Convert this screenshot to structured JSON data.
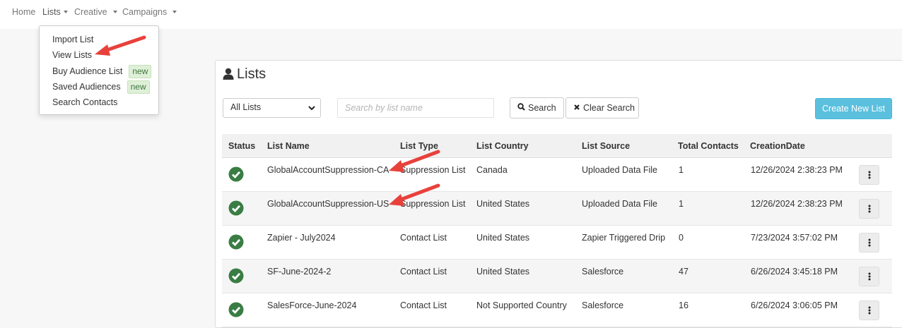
{
  "nav": {
    "home": "Home",
    "lists": "Lists",
    "creative": "Creative",
    "campaigns": "Campaigns"
  },
  "dropdown": {
    "items": [
      {
        "label": "Import List",
        "badge": ""
      },
      {
        "label": "View Lists",
        "badge": ""
      },
      {
        "label": "Buy Audience List",
        "badge": "new"
      },
      {
        "label": "Saved Audiences",
        "badge": "new"
      },
      {
        "label": "Search Contacts",
        "badge": ""
      }
    ]
  },
  "page": {
    "title": "Lists",
    "filter_selected": "All Lists",
    "search_placeholder": "Search by list name",
    "search_button": "Search",
    "clear_button": "Clear Search",
    "create_button": "Create New List"
  },
  "table": {
    "headers": [
      "Status",
      "List Name",
      "List Type",
      "List Country",
      "List Source",
      "Total Contacts",
      "CreationDate"
    ],
    "rows": [
      {
        "name": "GlobalAccountSuppression-CA",
        "type": "Suppression List",
        "country": "Canada",
        "source": "Uploaded Data File",
        "contacts": "1",
        "created": "12/26/2024 2:38:23 PM"
      },
      {
        "name": "GlobalAccountSuppression-US",
        "type": "Suppression List",
        "country": "United States",
        "source": "Uploaded Data File",
        "contacts": "1",
        "created": "12/26/2024 2:38:23 PM"
      },
      {
        "name": "Zapier - July2024",
        "type": "Contact List",
        "country": "United States",
        "source": "Zapier Triggered Drip",
        "contacts": "0",
        "created": "7/23/2024 3:57:02 PM"
      },
      {
        "name": "SF-June-2024-2",
        "type": "Contact List",
        "country": "United States",
        "source": "Salesforce",
        "contacts": "47",
        "created": "6/26/2024 3:45:18 PM"
      },
      {
        "name": "SalesForce-June-2024",
        "type": "Contact List",
        "country": "Not Supported Country",
        "source": "Salesforce",
        "contacts": "16",
        "created": "6/26/2024 3:06:05 PM"
      }
    ]
  },
  "icons": {
    "status": "check-circle-icon",
    "user": "user-icon",
    "search": "search-icon",
    "clear": "times-icon",
    "menu": "vertical-ellipsis-icon"
  },
  "colors": {
    "status_green": "#3a7d44",
    "primary_button": "#5bc0de",
    "badge_bg": "#dff0d8",
    "annotation_arrow": "#e8413c"
  }
}
